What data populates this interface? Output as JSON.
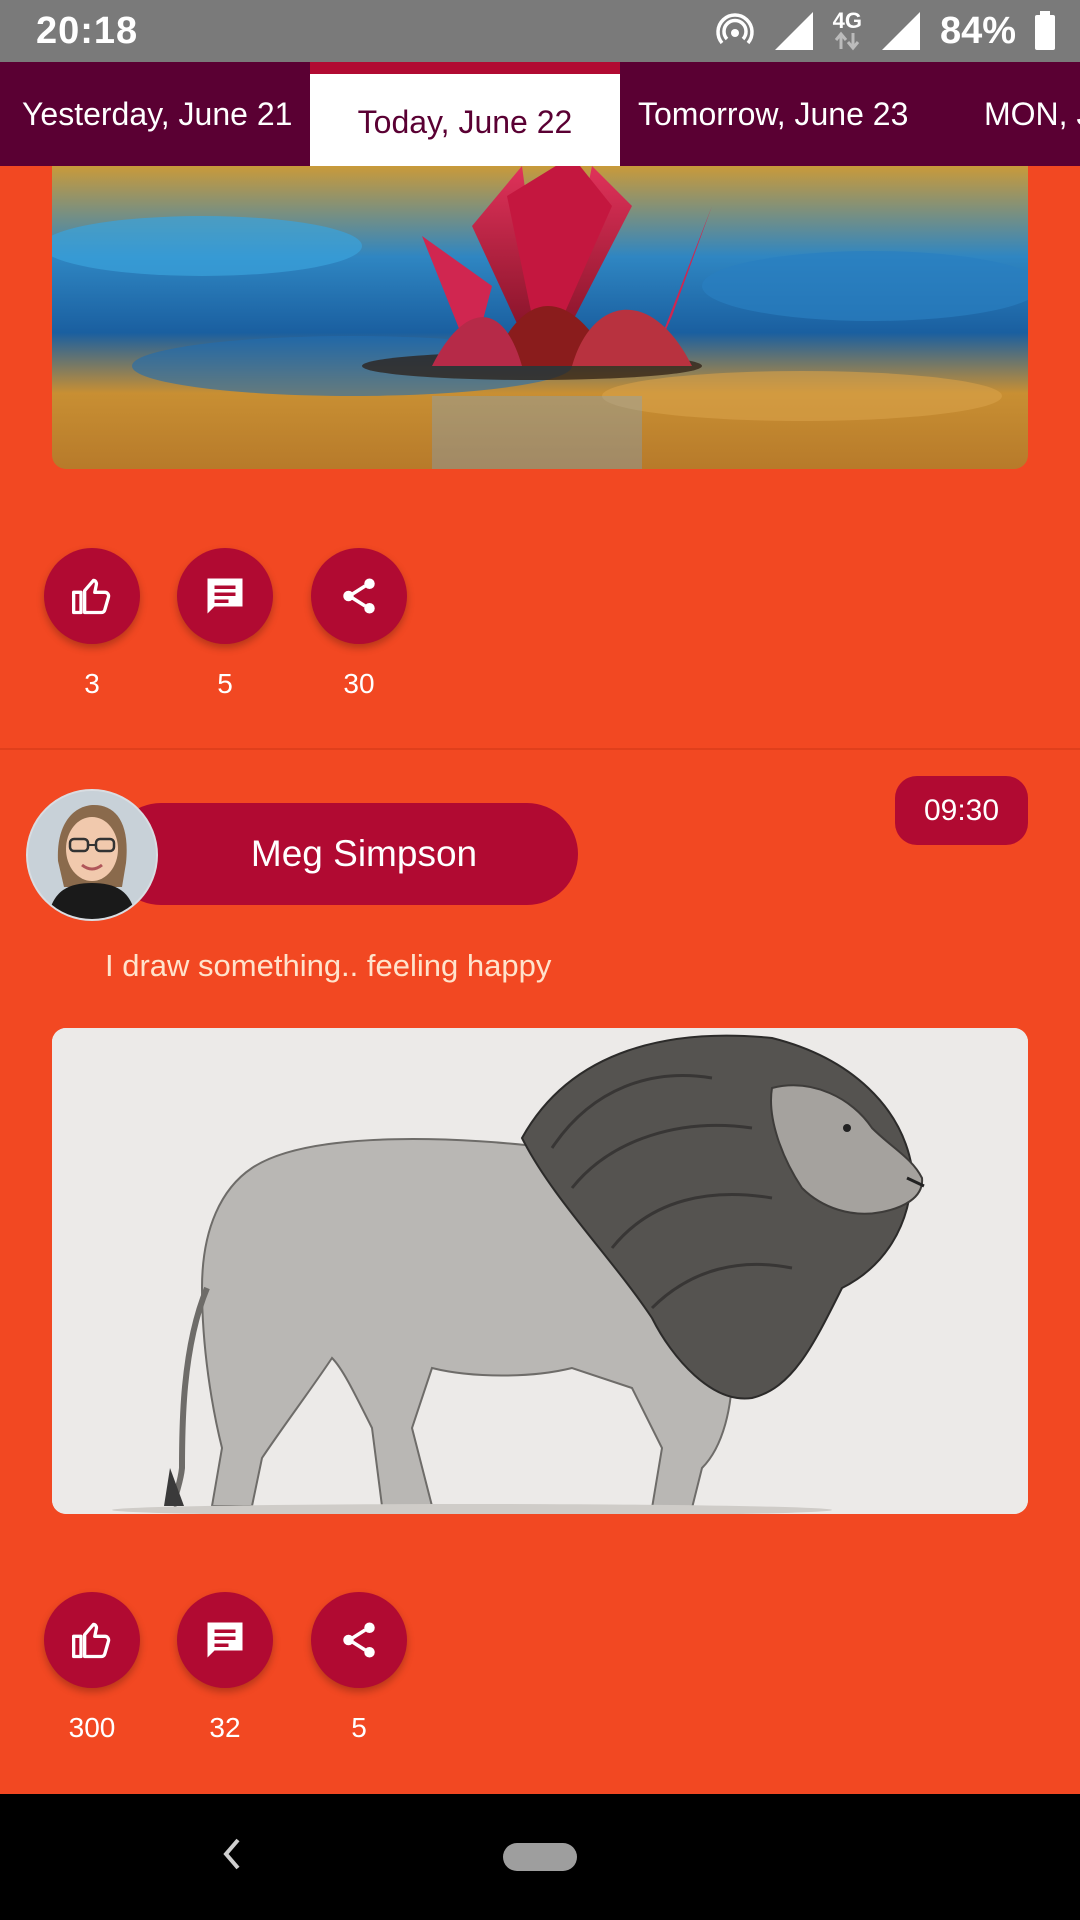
{
  "status_bar": {
    "time": "20:18",
    "network": "4G",
    "battery": "84%"
  },
  "tabs": [
    {
      "label": "Yesterday, June 21",
      "selected": false
    },
    {
      "label": "Today, June 22",
      "selected": true
    },
    {
      "label": "Tomorrow, June 23",
      "selected": false
    },
    {
      "label": "MON, J",
      "selected": false
    }
  ],
  "posts": [
    {
      "image_icon": "water-lily-photo",
      "likes": "3",
      "comments": "5",
      "shares": "30"
    },
    {
      "author": "Meg Simpson",
      "time": "09:30",
      "caption": "I draw something.. feeling happy",
      "image_icon": "lion-drawing",
      "likes": "300",
      "comments": "32",
      "shares": "5"
    }
  ],
  "colors": {
    "background": "#f24822",
    "accent": "#b10a32",
    "tab_bar": "#5a0033"
  }
}
